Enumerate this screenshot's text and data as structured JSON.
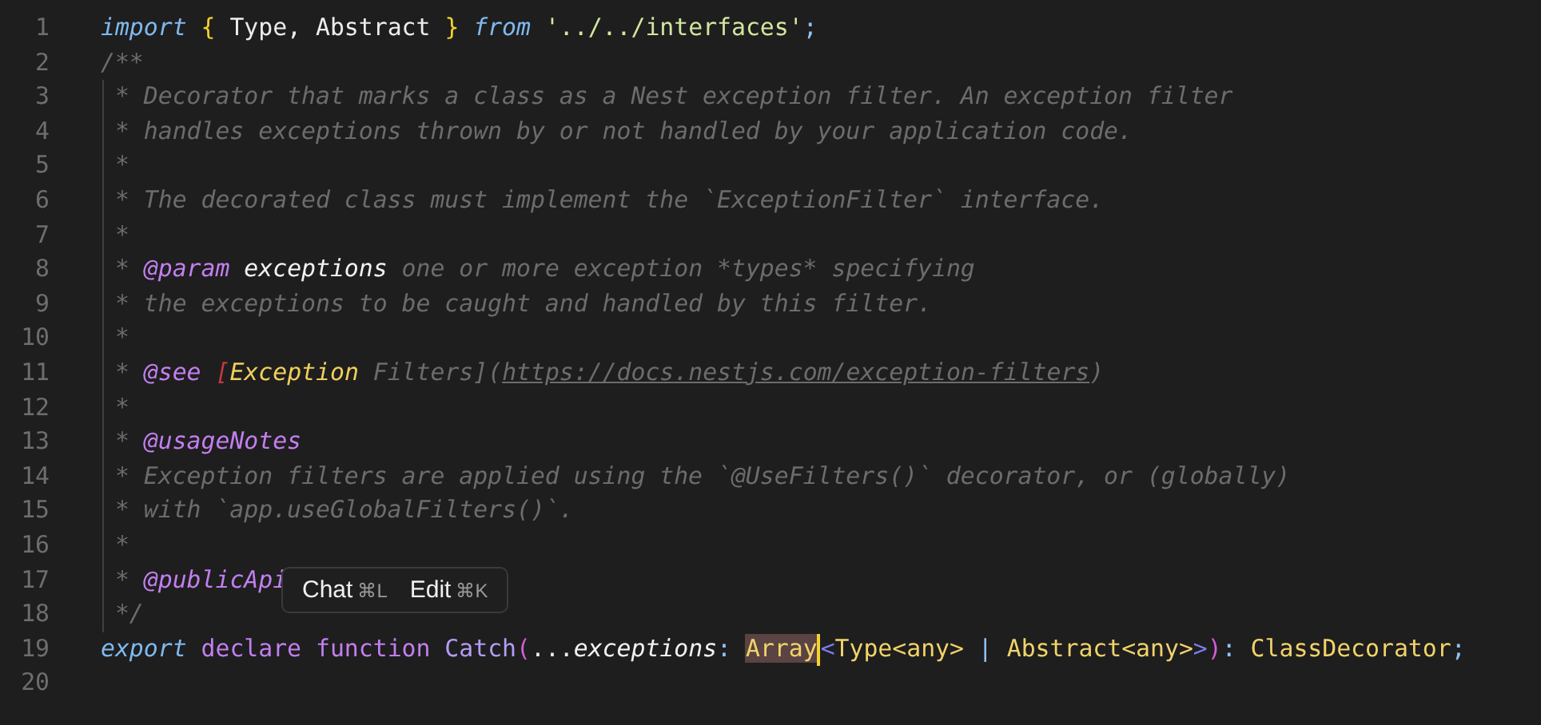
{
  "editor": {
    "lines": [
      {
        "number": "1",
        "tokens": [
          {
            "kind": "keyword",
            "text": "import"
          },
          {
            "kind": "brace",
            "text": " {"
          },
          {
            "kind": "plain",
            "text": " Type, Abstract "
          },
          {
            "kind": "brace",
            "text": "}"
          },
          {
            "kind": "keyword",
            "text": " from"
          },
          {
            "kind": "string",
            "text": " '../../interfaces'"
          },
          {
            "kind": "punct",
            "text": ";"
          }
        ]
      },
      {
        "number": "2",
        "tokens": [
          {
            "kind": "comment",
            "text": "/**"
          }
        ]
      },
      {
        "number": "3",
        "tokens": [
          {
            "kind": "comment",
            "text": " * Decorator that marks a class as a Nest exception filter. An exception filter"
          }
        ]
      },
      {
        "number": "4",
        "tokens": [
          {
            "kind": "comment",
            "text": " * handles exceptions thrown by or not handled by your application code."
          }
        ]
      },
      {
        "number": "5",
        "tokens": [
          {
            "kind": "comment",
            "text": " *"
          }
        ]
      },
      {
        "number": "6",
        "tokens": [
          {
            "kind": "comment",
            "text": " * The decorated class must implement the `ExceptionFilter` interface."
          }
        ]
      },
      {
        "number": "7",
        "tokens": [
          {
            "kind": "comment",
            "text": " *"
          }
        ]
      },
      {
        "number": "8",
        "tokens": [
          {
            "kind": "comment",
            "text": " * "
          },
          {
            "kind": "tag",
            "text": "@param"
          },
          {
            "kind": "param",
            "text": " exceptions"
          },
          {
            "kind": "comment",
            "text": " one or more exception *types* specifying"
          }
        ]
      },
      {
        "number": "9",
        "tokens": [
          {
            "kind": "comment",
            "text": " * the exceptions to be caught and handled by this filter."
          }
        ]
      },
      {
        "number": "10",
        "tokens": [
          {
            "kind": "comment",
            "text": " *"
          }
        ]
      },
      {
        "number": "11",
        "tokens": [
          {
            "kind": "comment",
            "text": " * "
          },
          {
            "kind": "tag",
            "text": "@see"
          },
          {
            "kind": "bracket",
            "text": " ["
          },
          {
            "kind": "linktext",
            "text": "Exception"
          },
          {
            "kind": "comment",
            "text": " Filters]("
          },
          {
            "kind": "link",
            "text": "https://docs.nestjs.com/exception-filters"
          },
          {
            "kind": "comment",
            "text": ")"
          }
        ]
      },
      {
        "number": "12",
        "tokens": [
          {
            "kind": "comment",
            "text": " *"
          }
        ]
      },
      {
        "number": "13",
        "tokens": [
          {
            "kind": "comment",
            "text": " * "
          },
          {
            "kind": "tag",
            "text": "@usageNotes"
          }
        ]
      },
      {
        "number": "14",
        "tokens": [
          {
            "kind": "comment",
            "text": " * Exception filters are applied using the `@UseFilters()` decorator, or (globally)"
          }
        ]
      },
      {
        "number": "15",
        "tokens": [
          {
            "kind": "comment",
            "text": " * with `app.useGlobalFilters()`."
          }
        ]
      },
      {
        "number": "16",
        "tokens": [
          {
            "kind": "comment",
            "text": " *"
          }
        ]
      },
      {
        "number": "17",
        "tokens": [
          {
            "kind": "comment",
            "text": " * "
          },
          {
            "kind": "tag",
            "text": "@publicApi"
          }
        ]
      },
      {
        "number": "18",
        "tokens": [
          {
            "kind": "comment",
            "text": " */"
          }
        ]
      },
      {
        "number": "19",
        "tokens": [
          {
            "kind": "keyword",
            "text": "export"
          },
          {
            "kind": "storage",
            "text": " declare"
          },
          {
            "kind": "storage",
            "text": " function"
          },
          {
            "kind": "function",
            "text": " Catch"
          },
          {
            "kind": "paren",
            "text": "("
          },
          {
            "kind": "plain",
            "text": "..."
          },
          {
            "kind": "param",
            "text": "exceptions"
          },
          {
            "kind": "punct",
            "text": ": "
          },
          {
            "kind": "type",
            "text": "Array",
            "highlighted": true,
            "cursor_after": true
          },
          {
            "kind": "angle",
            "text": "<"
          },
          {
            "kind": "type",
            "text": "Type<any>"
          },
          {
            "kind": "punct",
            "text": " | "
          },
          {
            "kind": "type",
            "text": "Abstract<any>"
          },
          {
            "kind": "angle",
            "text": ">"
          },
          {
            "kind": "paren",
            "text": ")"
          },
          {
            "kind": "punct",
            "text": ":"
          },
          {
            "kind": "type",
            "text": " ClassDecorator"
          },
          {
            "kind": "punct",
            "text": ";"
          }
        ]
      },
      {
        "number": "20"
      }
    ]
  },
  "popup": {
    "actions": [
      {
        "label": "Chat",
        "shortcut": "⌘L"
      },
      {
        "label": "Edit",
        "shortcut": "⌘K"
      }
    ]
  }
}
